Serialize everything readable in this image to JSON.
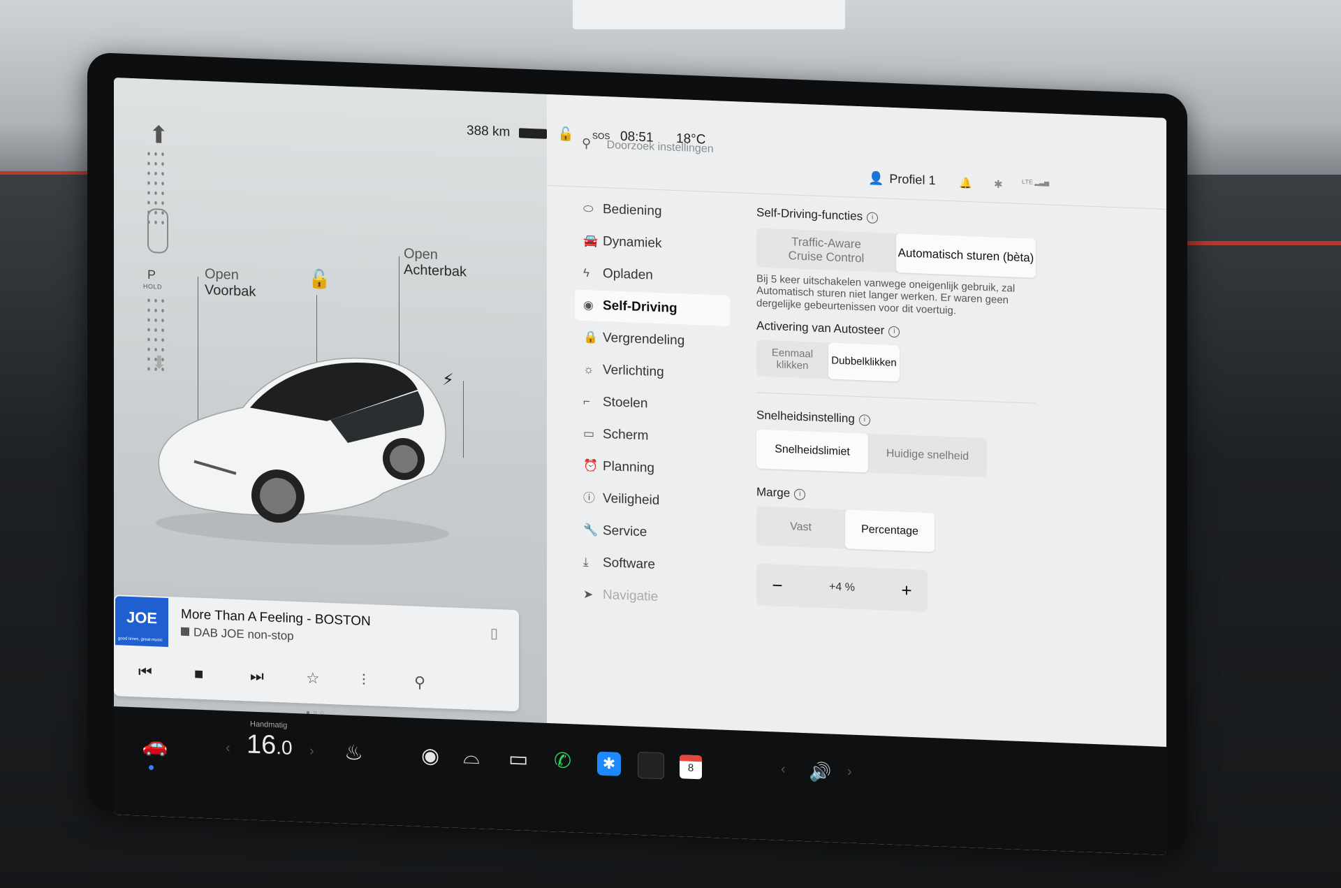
{
  "status": {
    "range": "388 km",
    "sos": "SOS",
    "time": "08:51",
    "temperature": "18°C",
    "network": "LTE"
  },
  "gear": {
    "letter": "P",
    "hold": "HOLD"
  },
  "car": {
    "frunk_label_1": "Open",
    "frunk_label_2": "Voorbak",
    "trunk_label_1": "Open",
    "trunk_label_2": "Achterbak"
  },
  "media": {
    "logo": "JOE",
    "logo_tagline": "good times, great music",
    "title": "More Than A Feeling - BOSTON",
    "subtitle": "DAB JOE non-stop"
  },
  "settings": {
    "search_placeholder": "Doorzoek instellingen",
    "profile": "Profiel 1",
    "nav": [
      {
        "label": "Bediening",
        "icon": "toggle-icon"
      },
      {
        "label": "Dynamiek",
        "icon": "car-icon"
      },
      {
        "label": "Opladen",
        "icon": "bolt-icon"
      },
      {
        "label": "Self-Driving",
        "icon": "steering-wheel-icon",
        "active": true
      },
      {
        "label": "Vergrendeling",
        "icon": "lock-icon"
      },
      {
        "label": "Verlichting",
        "icon": "sun-icon"
      },
      {
        "label": "Stoelen",
        "icon": "seat-icon"
      },
      {
        "label": "Scherm",
        "icon": "display-icon"
      },
      {
        "label": "Planning",
        "icon": "alarm-icon"
      },
      {
        "label": "Veiligheid",
        "icon": "info-circle-icon"
      },
      {
        "label": "Service",
        "icon": "wrench-icon"
      },
      {
        "label": "Software",
        "icon": "download-icon"
      },
      {
        "label": "Navigatie",
        "icon": "navigate-icon"
      }
    ],
    "self_driving": {
      "section_title": "Self-Driving-functies",
      "opt_tacc_1": "Traffic-Aware",
      "opt_tacc_2": "Cruise Control",
      "opt_autosteer": "Automatisch sturen (bèta)",
      "note": "Bij 5 keer uitschakelen vanwege oneigenlijk gebruik, zal Automatisch sturen niet langer werken. Er waren geen dergelijke gebeurtenissen voor dit voertuig.",
      "activation_title": "Activering van Autosteer",
      "opt_single": "Eenmaal klikken",
      "opt_double": "Dubbelklikken",
      "speed_title": "Snelheidsinstelling",
      "opt_limit": "Snelheidslimiet",
      "opt_current": "Huidige snelheid",
      "margin_title": "Marge",
      "opt_fixed": "Vast",
      "opt_percent": "Percentage",
      "offset": "+4 %",
      "minus": "−",
      "plus": "+"
    }
  },
  "dock": {
    "temp_mode": "Handmatig",
    "temp_int": "16",
    "temp_dec": ".0",
    "calendar_day": "8"
  }
}
